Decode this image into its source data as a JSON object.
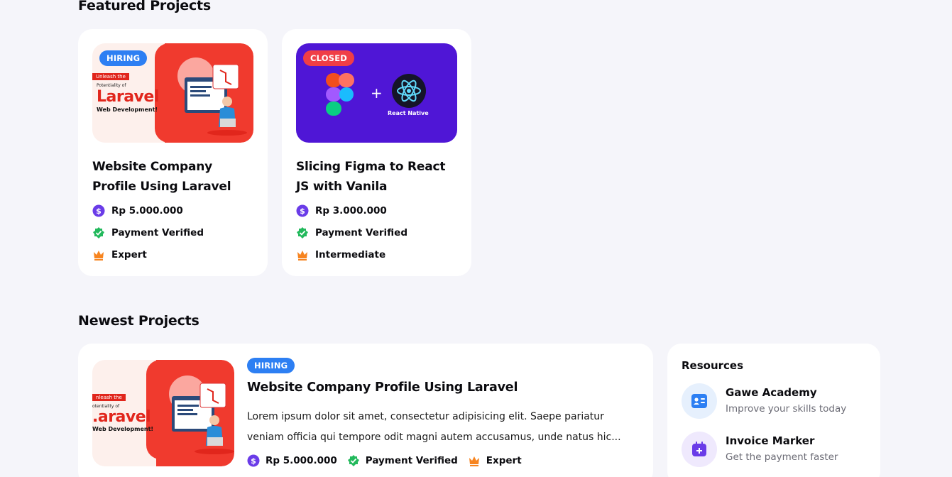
{
  "featured": {
    "title": "Featured Projects",
    "cards": [
      {
        "badge": "HIRING",
        "title": "Website Company Profile Using Laravel",
        "price": "Rp 5.000.000",
        "payment": "Payment Verified",
        "level": "Expert",
        "thumb": {
          "tag": "Unleash the",
          "small": "Potentiality of",
          "big": "Laravel",
          "sub": "Web Development!"
        }
      },
      {
        "badge": "CLOSED",
        "title": "Slicing Figma to React JS with Vanila",
        "price": "Rp 3.000.000",
        "payment": "Payment Verified",
        "level": "Intermediate",
        "thumb": {
          "plus": "+",
          "react_label": "React Native"
        }
      }
    ]
  },
  "newest": {
    "title": "Newest Projects",
    "item": {
      "badge": "HIRING",
      "title": "Website Company Profile Using Laravel",
      "description": "Lorem ipsum dolor sit amet, consectetur adipisicing elit. Saepe pariatur veniam officia qui tempore odit magni autem accusamus, unde natus hic...",
      "price": "Rp 5.000.000",
      "payment": "Payment Verified",
      "level": "Expert",
      "thumb": {
        "tag": "nleash the",
        "small": "otentiality of",
        "big": ".aravel",
        "sub": "Web Development!"
      }
    }
  },
  "resources": {
    "title": "Resources",
    "items": [
      {
        "name": "Gawe Academy",
        "sub": "Improve your skills today",
        "icon": "id-card-icon"
      },
      {
        "name": "Invoice Marker",
        "sub": "Get the payment faster",
        "icon": "calendar-plus-icon"
      }
    ]
  },
  "colors": {
    "hiring": "#2d7ff3",
    "closed": "#f03e46",
    "price_icon": "#6a3ce8",
    "verified_icon": "#22b95c",
    "crown_icon": "#f7841f"
  }
}
